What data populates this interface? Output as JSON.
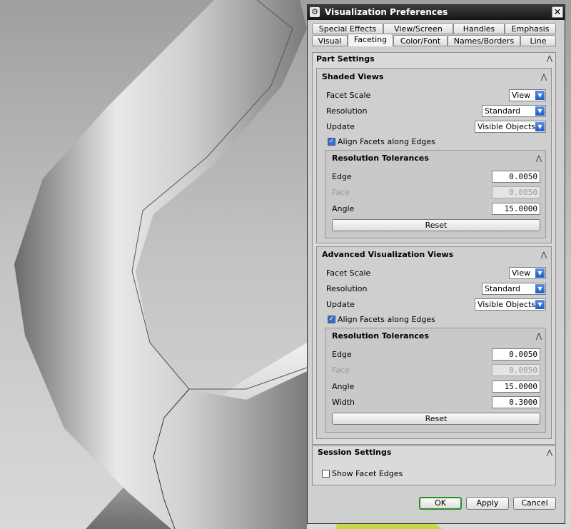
{
  "dialog": {
    "title": "Visualization Preferences"
  },
  "tabs": {
    "row1": [
      "Special Effects",
      "View/Screen",
      "Handles",
      "Emphasis"
    ],
    "row2": [
      "Visual",
      "Faceting",
      "Color/Font",
      "Names/Borders",
      "Line"
    ],
    "active": "Faceting"
  },
  "part_settings": {
    "title": "Part Settings",
    "shaded": {
      "title": "Shaded Views",
      "facet_scale_label": "Facet Scale",
      "facet_scale_value": "View",
      "resolution_label": "Resolution",
      "resolution_value": "Standard",
      "update_label": "Update",
      "update_value": "Visible Objects",
      "align_label": "Align Facets along Edges",
      "align_checked": true,
      "tol": {
        "title": "Resolution Tolerances",
        "edge_label": "Edge",
        "edge_value": "0.0050",
        "face_label": "Face",
        "face_value": "0.0050",
        "angle_label": "Angle",
        "angle_value": "15.0000",
        "reset_label": "Reset"
      }
    },
    "advanced": {
      "title": "Advanced Visualization Views",
      "facet_scale_label": "Facet Scale",
      "facet_scale_value": "View",
      "resolution_label": "Resolution",
      "resolution_value": "Standard",
      "update_label": "Update",
      "update_value": "Visible Objects",
      "align_label": "Align Facets along Edges",
      "align_checked": true,
      "tol": {
        "title": "Resolution Tolerances",
        "edge_label": "Edge",
        "edge_value": "0.0050",
        "face_label": "Face",
        "face_value": "0.0050",
        "angle_label": "Angle",
        "angle_value": "15.0000",
        "width_label": "Width",
        "width_value": "0.3000",
        "reset_label": "Reset"
      }
    }
  },
  "session_settings": {
    "title": "Session Settings",
    "show_facet_edges_label": "Show Facet Edges",
    "show_facet_edges_checked": false
  },
  "buttons": {
    "ok": "OK",
    "apply": "Apply",
    "cancel": "Cancel"
  },
  "colors": {
    "accent": "#2f6fd6",
    "ok_border": "#2a8c2a",
    "titlebar": "#1c1c1c"
  }
}
